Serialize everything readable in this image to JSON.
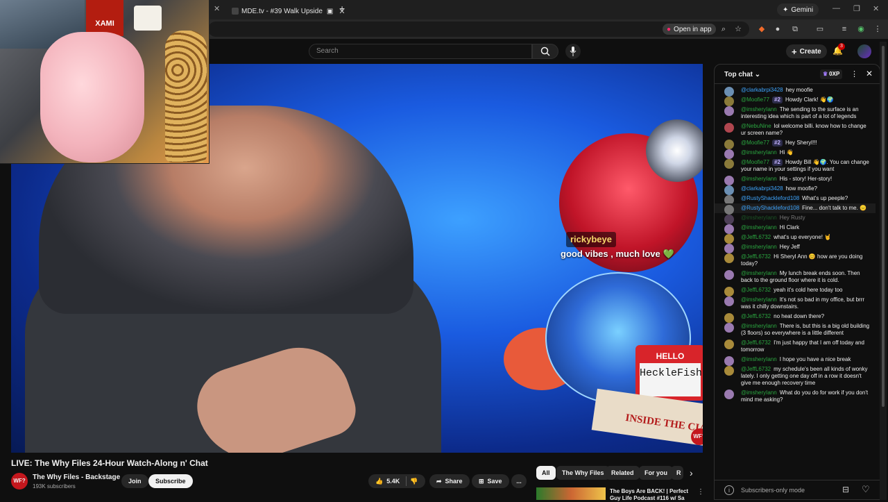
{
  "browser": {
    "tab_title": "MDE.tv - #39 Walk Upside",
    "new_tab": "+",
    "gemini_label": "Gemini",
    "open_in_app": "Open in app"
  },
  "masthead": {
    "search_placeholder": "Search",
    "create_label": "Create",
    "notification_count": "3"
  },
  "video": {
    "overlay_username": "rickybeye",
    "overlay_message": "good vibes , much love",
    "overlay_heart": "💚",
    "nametag_text": "HeckleFish",
    "book_text": "INSIDE THE CIA",
    "corner_badge": "WF?",
    "webcam_poster_text": "XAMI"
  },
  "below_video": {
    "title": "LIVE: The Why Files 24-Hour Watch-Along n' Chat",
    "channel_avatar": "WF?",
    "channel_name": "The Why Files - Backstage",
    "subscribers": "193K subscribers",
    "join_label": "Join",
    "subscribe_label": "Subscribe",
    "like_count": "5.4K",
    "share_label": "Share",
    "save_label": "Save",
    "more_label": "..."
  },
  "chips": [
    "All",
    "The Why Files",
    "Related",
    "For you",
    "R"
  ],
  "recommended": {
    "title": "The Boys Are BACK! | Perfect Guy Life Podcast #116 w/ Sa"
  },
  "chat": {
    "header_title": "Top chat",
    "xp_label": "0XP",
    "footer_mode": "Subscribers-only mode",
    "messages": [
      {
        "author": "@clarkabrpi3428",
        "badge": "",
        "text": "hey moofie",
        "color": "#6b8fb3",
        "member": false,
        "style": ""
      },
      {
        "author": "@Moofie77",
        "badge": "#2",
        "text": "Howdy Clark! 👋🌍",
        "color": "#8a7a3a",
        "member": true,
        "style": ""
      },
      {
        "author": "@imsheryIann",
        "badge": "",
        "text": "The sending to the surface is an interesting idea which is part of a lot of legends",
        "color": "#9a7ab0",
        "member": true,
        "style": ""
      },
      {
        "author": "@NebuNine",
        "badge": "",
        "text": "lol welcome billi. know how to change ur screen name?",
        "color": "#b0464f",
        "member": true,
        "style": ""
      },
      {
        "author": "@Moofie77",
        "badge": "#2",
        "text": "Hey Sheryl!!!",
        "color": "#8a7a3a",
        "member": true,
        "style": ""
      },
      {
        "author": "@imsheryIann",
        "badge": "",
        "text": "Hi 👋",
        "color": "#9a7ab0",
        "member": true,
        "style": ""
      },
      {
        "author": "@Moofie77",
        "badge": "#2",
        "text": "Howdy Bill 👋🌍. You can change your name in your settings if you want",
        "color": "#8a7a3a",
        "member": true,
        "style": ""
      },
      {
        "author": "@imsheryIann",
        "badge": "",
        "text": "His - story! Her-story!",
        "color": "#9a7ab0",
        "member": true,
        "style": ""
      },
      {
        "author": "@clarkabrpi3428",
        "badge": "",
        "text": "how moofie?",
        "color": "#6b8fb3",
        "member": false,
        "style": ""
      },
      {
        "author": "@RustyShackleford108",
        "badge": "",
        "text": "What's up peeple?",
        "color": "#777777",
        "member": false,
        "style": ""
      },
      {
        "author": "@RustyShackleford108",
        "badge": "",
        "text": "Fine... don't talk to me. 😑",
        "color": "#777777",
        "member": false,
        "style": "hl"
      },
      {
        "author": "@imsheryIann",
        "badge": "",
        "text": "Hey Rusty",
        "color": "#9a7ab0",
        "member": true,
        "style": "dim"
      },
      {
        "author": "@imsheryIann",
        "badge": "",
        "text": "Hi Clark",
        "color": "#9a7ab0",
        "member": true,
        "style": ""
      },
      {
        "author": "@JeffL6732",
        "badge": "",
        "text": "what's up everyone! 🤘",
        "color": "#a88a3a",
        "member": true,
        "style": ""
      },
      {
        "author": "@imsheryIann",
        "badge": "",
        "text": "Hey Jeff",
        "color": "#9a7ab0",
        "member": true,
        "style": ""
      },
      {
        "author": "@JeffL6732",
        "badge": "",
        "text": "Hi Sheryl Ann 😊 how are you doing today?",
        "color": "#a88a3a",
        "member": true,
        "style": ""
      },
      {
        "author": "@imsheryIann",
        "badge": "",
        "text": "My lunch break ends soon. Then back to the ground floor where it is cold.",
        "color": "#9a7ab0",
        "member": true,
        "style": ""
      },
      {
        "author": "@JeffL6732",
        "badge": "",
        "text": "yeah it's cold here today too",
        "color": "#a88a3a",
        "member": true,
        "style": ""
      },
      {
        "author": "@imsheryIann",
        "badge": "",
        "text": "It's not so bad in my office, but brrr was it chilly downstairs.",
        "color": "#9a7ab0",
        "member": true,
        "style": ""
      },
      {
        "author": "@JeffL6732",
        "badge": "",
        "text": "no heat down there?",
        "color": "#a88a3a",
        "member": true,
        "style": ""
      },
      {
        "author": "@imsheryIann",
        "badge": "",
        "text": "There is, but this is a big old building (3 floors) so everywhere is a little different",
        "color": "#9a7ab0",
        "member": true,
        "style": ""
      },
      {
        "author": "@JeffL6732",
        "badge": "",
        "text": "I'm just happy that I am off today and tomorrow",
        "color": "#a88a3a",
        "member": true,
        "style": ""
      },
      {
        "author": "@imsheryIann",
        "badge": "",
        "text": "I hope you have a nice break",
        "color": "#9a7ab0",
        "member": true,
        "style": ""
      },
      {
        "author": "@JeffL6732",
        "badge": "",
        "text": "my schedule's been all kinds of wonky lately. I only getting one day off in a row it doesn't give me enough recovery time",
        "color": "#a88a3a",
        "member": true,
        "style": ""
      },
      {
        "author": "@imsheryIann",
        "badge": "",
        "text": "What do you do for work if you don't mind me asking?",
        "color": "#9a7ab0",
        "member": true,
        "style": ""
      }
    ]
  }
}
